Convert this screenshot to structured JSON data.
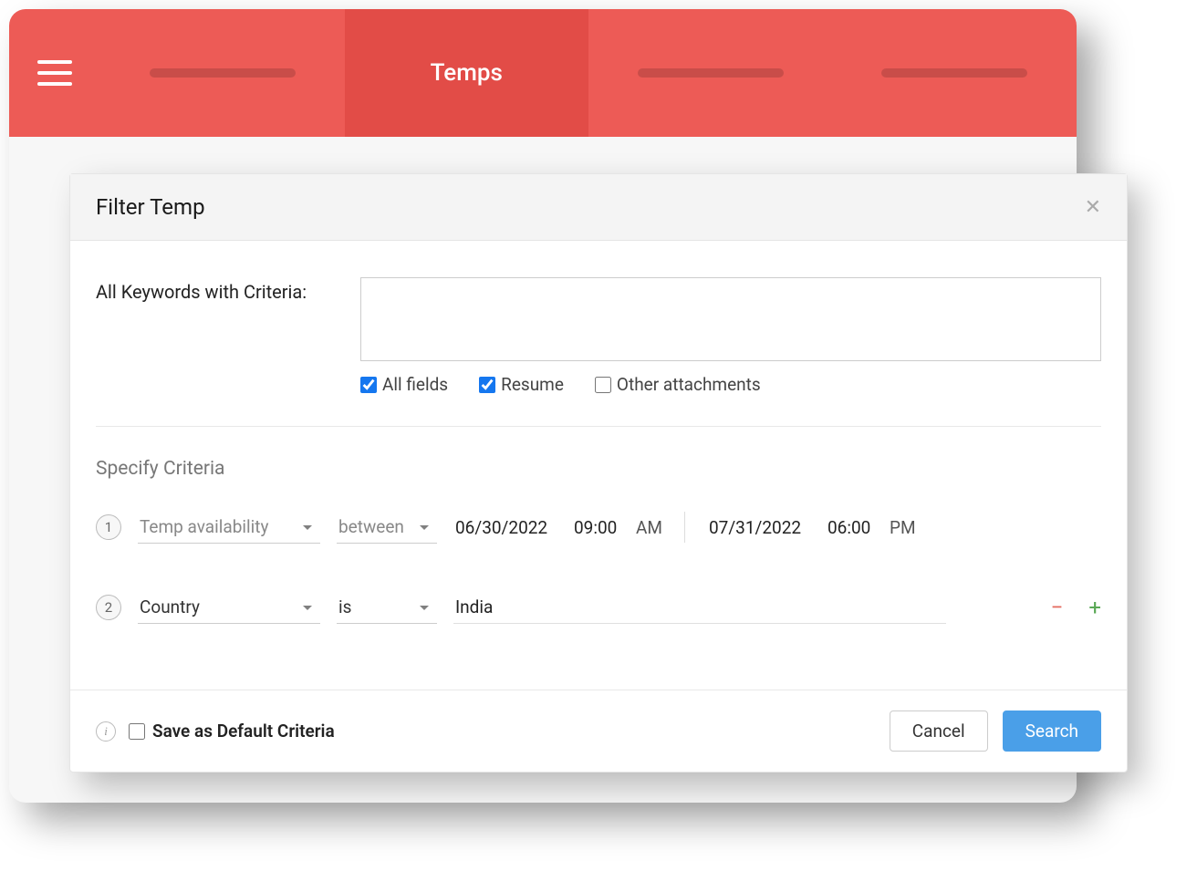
{
  "header": {
    "active_tab_label": "Temps"
  },
  "modal": {
    "title": "Filter Temp",
    "keywords_label": "All Keywords with Criteria:",
    "keywords_value": "",
    "checks": {
      "all_fields": {
        "label": "All fields",
        "checked": true
      },
      "resume": {
        "label": "Resume",
        "checked": true
      },
      "other": {
        "label": "Other attachments",
        "checked": false
      }
    },
    "specify_title": "Specify Criteria",
    "criteria": [
      {
        "num": "1",
        "field": "Temp availability",
        "operator": "between",
        "from_date": "06/30/2022",
        "from_time": "09:00",
        "from_meridiem": "AM",
        "to_date": "07/31/2022",
        "to_time": "06:00",
        "to_meridiem": "PM"
      },
      {
        "num": "2",
        "field": "Country",
        "operator": "is",
        "value": "India"
      }
    ],
    "footer": {
      "save_default_label": "Save as Default Criteria",
      "cancel_label": "Cancel",
      "search_label": "Search"
    }
  }
}
